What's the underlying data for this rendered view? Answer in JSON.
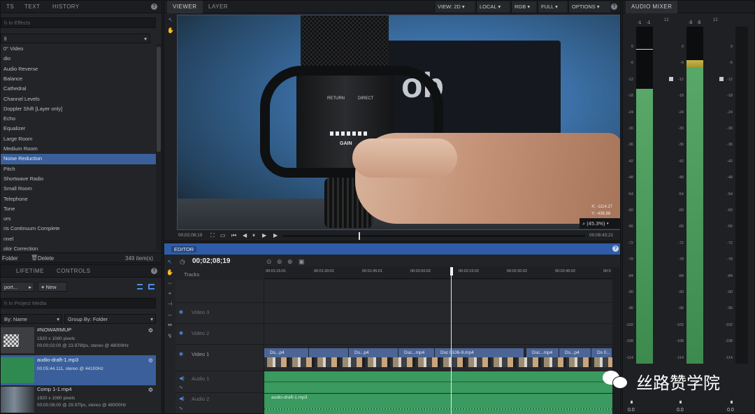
{
  "effects_panel": {
    "tabs": [
      "TS",
      "TEXT",
      "HISTORY"
    ],
    "search_placeholder": "h In Effects",
    "category": "ll",
    "items": [
      "0° Video",
      "dio",
      "Audio Reverse",
      "Balance",
      "Cathedral",
      "Channel Levels",
      "Doppler Shift [Layer only]",
      "Echo",
      "Equalizer",
      "Large Room",
      "Medium Room",
      "Noise Reduction",
      "Pitch",
      "Shortwave Radio",
      "Small Room",
      "Telephone",
      "Tone",
      "urs",
      "ris Continuum Complete",
      "nnel",
      "olor Correction"
    ],
    "selected_index": 11,
    "footer_folder": "Folder",
    "footer_delete": "Delete",
    "item_count": "349 item(s)"
  },
  "media_panel": {
    "tabs": [
      "",
      "LIFETIME",
      "CONTROLS"
    ],
    "import_label": "port...",
    "new_label": "New",
    "search_placeholder": "h In Project Media",
    "sort_label": "By: Name",
    "group_label": "Group By: Folder",
    "items": [
      {
        "name": "#NOWARMUP",
        "meta1": "1920 x 1080 pixels",
        "meta2": "00;00;02;00 @ 23.976fps, stereo @ 48000Hz"
      },
      {
        "name": "audio-draft-1.mp3",
        "meta1": "00;05;44.111, stereo @ 44100Hz",
        "meta2": ""
      },
      {
        "name": "Comp 1-1.mp4",
        "meta1": "1920 x 1080 pixels",
        "meta2": "00;00;08;00 @ 29.97fps, stereo @ 48000Hz"
      }
    ]
  },
  "viewer": {
    "tabs": [
      "VIEWER",
      "LAYER"
    ],
    "options": [
      "VIEW: 2D",
      "LOCAL",
      "RGB",
      "FULL",
      "OPTIONS"
    ],
    "coord_x": "X: -1114.27",
    "coord_y": "Y: -436.88",
    "zoom": "(45.3%)",
    "time_start": "00;02;08;19",
    "time_end": "00;08;43;21",
    "mic_text": [
      "RETURN",
      "DIRECT",
      "GAIN",
      "R"
    ]
  },
  "editor": {
    "title": "EDITOR",
    "timecode": "00;02;08;19",
    "tracks_label": "Tracks",
    "ruler": [
      "00:01:15:01",
      "00:01:30:01",
      "00:01:45:01",
      "00:02:00:02",
      "00:02:15:02",
      "00:02:30:02",
      "00:02:45:02",
      "00:0"
    ],
    "tracks": [
      "Video 3",
      "Video 2",
      "Video 1",
      "Audio 1",
      "Audio 2"
    ],
    "video_clips": [
      "Ds...p4",
      "Ds...p4",
      "Dsc...mp4",
      "Dsc 0106-9.mp4",
      "Dsc...mp4",
      "Ds...p4",
      "Ds 0..."
    ],
    "audio2_clip": "audio-draft-1.mp3"
  },
  "audio_mixer": {
    "title": "AUDIO MIXER",
    "peak_labels": [
      "-1",
      "-1",
      "12",
      "-5",
      "-5",
      "12"
    ],
    "scale": [
      "0",
      "-6",
      "-12",
      "-18",
      "-24",
      "-30",
      "-36",
      "-42",
      "-48",
      "-54",
      "-60",
      "-66",
      "-72",
      "-78",
      "-84",
      "-90",
      "-96",
      "-102",
      "-108",
      "-114"
    ],
    "values": [
      "0.0",
      "0.0",
      "0.0"
    ],
    "levels": [
      0.43,
      0.9
    ]
  },
  "watermark": {
    "text": "丝路赞学院"
  },
  "colors": {
    "accent": "#3a5f9b",
    "editor_bar": "#2f5ca8",
    "meter_green": "#4e9e5f",
    "meter_yellow": "#c4b040"
  }
}
